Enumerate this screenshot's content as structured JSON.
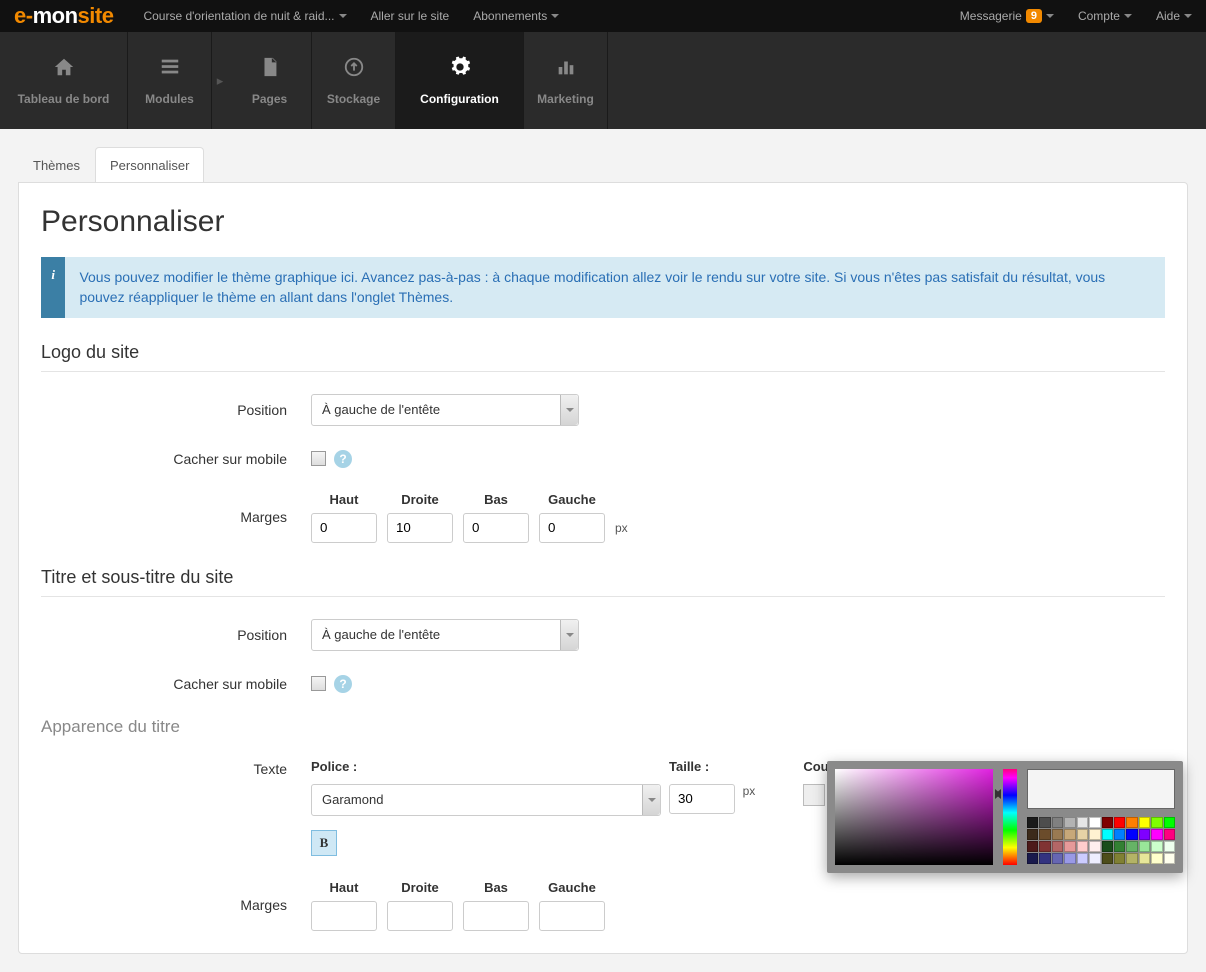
{
  "top": {
    "site_dropdown": "Course d'orientation de nuit & raid...",
    "go_to_site": "Aller sur le site",
    "subscriptions": "Abonnements",
    "messaging": "Messagerie",
    "messaging_count": "9",
    "account": "Compte",
    "help": "Aide"
  },
  "nav": [
    {
      "label": "Tableau de bord",
      "icon": "home"
    },
    {
      "label": "Modules",
      "icon": "list"
    },
    {
      "label": "Pages",
      "icon": "file"
    },
    {
      "label": "Stockage",
      "icon": "upload"
    },
    {
      "label": "Configuration",
      "icon": "gear",
      "active": true
    },
    {
      "label": "Marketing",
      "icon": "bars"
    }
  ],
  "tabs": {
    "themes": "Thèmes",
    "customize": "Personnaliser"
  },
  "page": {
    "title": "Personnaliser",
    "info": "Vous pouvez modifier le thème graphique ici. Avancez pas-à-pas : à chaque modification allez voir le rendu sur votre site. Si vous n'êtes pas satisfait du résultat, vous pouvez réappliquer le thème en allant dans l'onglet Thèmes."
  },
  "sections": {
    "logo_title": "Logo du site",
    "title_subtitle": "Titre et sous-titre du site",
    "title_appearance": "Apparence du titre"
  },
  "labels": {
    "position": "Position",
    "hide_on_mobile": "Cacher sur mobile",
    "margins": "Marges",
    "text": "Texte",
    "font": "Police :",
    "size": "Taille :",
    "color": "Couleur :",
    "px": "px"
  },
  "margin_headers": {
    "top": "Haut",
    "right": "Droite",
    "bottom": "Bas",
    "left": "Gauche"
  },
  "logo": {
    "position": "À gauche de l'entête",
    "margins": {
      "top": "0",
      "right": "10",
      "bottom": "0",
      "left": "0"
    }
  },
  "site_title": {
    "position": "À gauche de l'entête",
    "font": "Garamond",
    "size": "30"
  },
  "color_picker": {
    "swatches": [
      "#1a1a1a",
      "#4d4d4d",
      "#808080",
      "#b3b3b3",
      "#e6e6e6",
      "#ffffff",
      "#7f0000",
      "#ff0000",
      "#ff7f00",
      "#ffff00",
      "#7fff00",
      "#00ff00",
      "#3c2a1a",
      "#6b4c2b",
      "#997a52",
      "#c7a879",
      "#e6d2a6",
      "#fff2d1",
      "#00ffff",
      "#007fff",
      "#0000ff",
      "#7f00ff",
      "#ff00ff",
      "#ff007f",
      "#4d1a1a",
      "#803333",
      "#b36666",
      "#e69999",
      "#ffcccc",
      "#ffeeee",
      "#1a4d1a",
      "#338033",
      "#66b366",
      "#99e699",
      "#ccffcc",
      "#eeffee",
      "#1a1a4d",
      "#333380",
      "#6666b3",
      "#9999e6",
      "#ccccff",
      "#eeeeff",
      "#4d4d1a",
      "#808033",
      "#b3b366",
      "#e6e699",
      "#ffffcc",
      "#ffffee"
    ]
  }
}
